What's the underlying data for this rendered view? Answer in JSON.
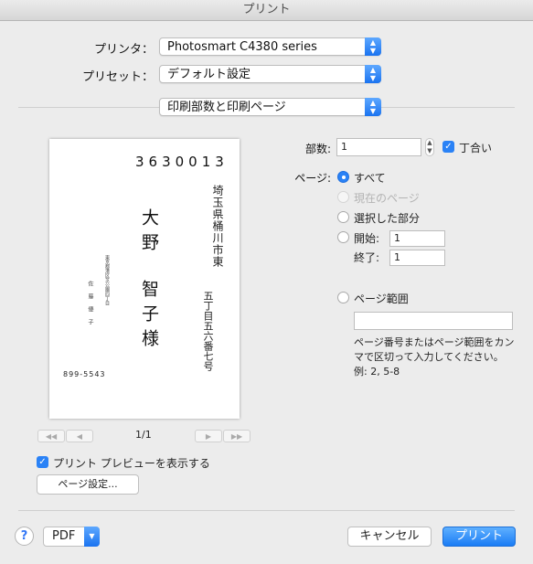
{
  "window": {
    "title": "プリント"
  },
  "printer": {
    "label": "プリンタ：",
    "value": "Photosmart C4380 series"
  },
  "preset": {
    "label": "プリセット：",
    "value": "デフォルト設定"
  },
  "section": {
    "value": "印刷部数と印刷ページ"
  },
  "preview": {
    "postal_code": "3630013",
    "addr1": "埼玉県桶川市東",
    "addr2": "五丁目五六番七号",
    "name1": "大野",
    "name2": "智子様",
    "sender_addr": "東京都港区芝公園四丁目",
    "sender_name": "佐藤優子",
    "sender_postal": "899-5543"
  },
  "nav": {
    "first": "◀◀",
    "prev": "◀",
    "next": "▶",
    "last": "▶▶",
    "page_indicator": "1/1"
  },
  "copies": {
    "label": "部数:",
    "value": "1",
    "collate_label": "丁合い"
  },
  "pages": {
    "label": "ページ:",
    "all": "すべて",
    "current": "現在のページ",
    "selection": "選択した部分",
    "from_label": "開始:",
    "from_value": "1",
    "to_label": "終了:",
    "to_value": "1",
    "range_label": "ページ範囲",
    "range_value": "",
    "hint": "ページ番号またはページ範囲をカン\nマで区切って入力してください。\n例: 2, 5-8"
  },
  "show_preview": {
    "label": "プリント プレビューを表示する"
  },
  "page_setup": {
    "label": "ページ設定..."
  },
  "footer": {
    "help": "?",
    "pdf": "PDF",
    "cancel": "キャンセル",
    "print": "プリント"
  },
  "colors": {
    "accent": "#2a82f6"
  }
}
